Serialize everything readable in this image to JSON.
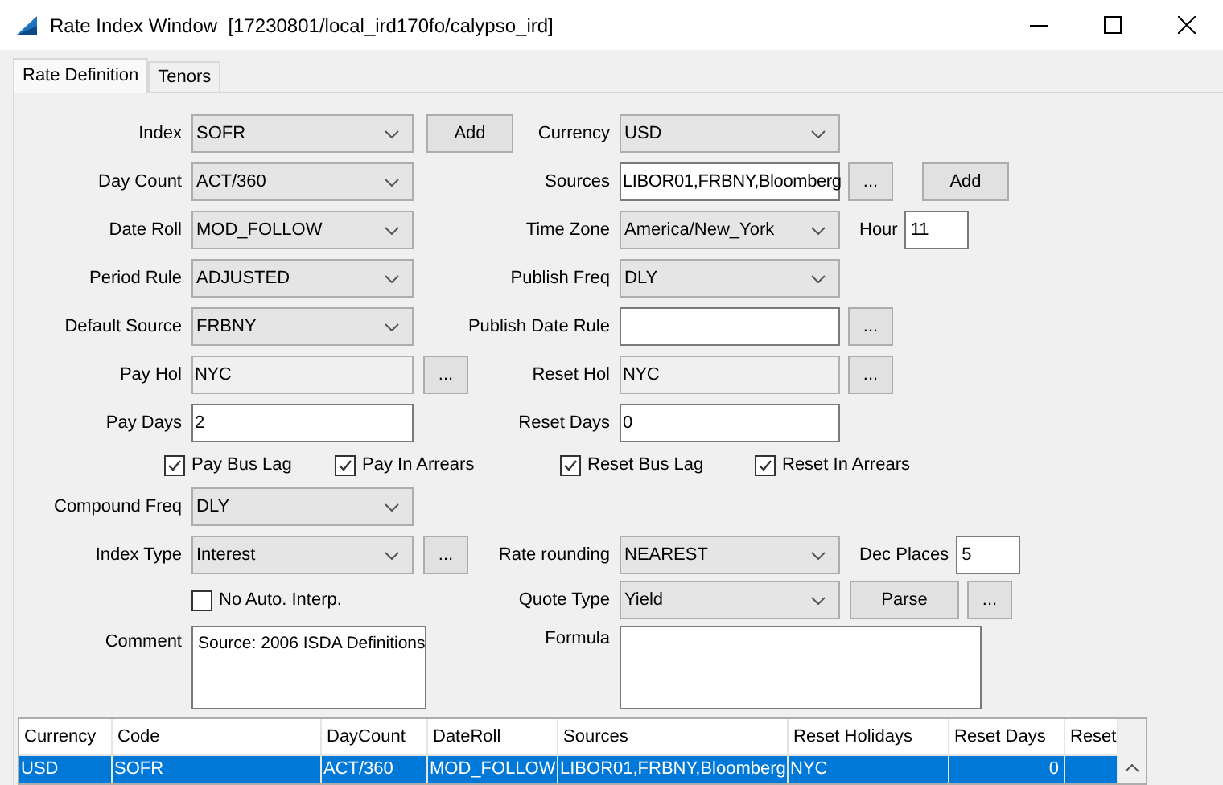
{
  "window": {
    "title": "Rate Index Window  [17230801/local_ird170fo/calypso_ird]"
  },
  "tabs": [
    {
      "label": "Rate Definition",
      "selected": true
    },
    {
      "label": "Tenors",
      "selected": false
    }
  ],
  "rows": [
    {
      "kind": "fields",
      "left": {
        "label": "Index",
        "field": {
          "kind": "dropdown",
          "value": "SOFR"
        },
        "button": "Add"
      },
      "right": {
        "label": "Currency",
        "field": {
          "kind": "dropdown",
          "value": "USD"
        }
      }
    },
    {
      "kind": "fields",
      "left": {
        "label": "Day Count",
        "field": {
          "kind": "dropdown",
          "value": "ACT/360"
        }
      },
      "right": {
        "label": "Sources",
        "field": {
          "kind": "text",
          "value": "LIBOR01,FRBNY,Bloomberg",
          "editable": true
        },
        "extras": [
          {
            "kind": "more",
            "label": "..."
          },
          {
            "kind": "button",
            "label": "Add"
          }
        ]
      }
    },
    {
      "kind": "fields",
      "left": {
        "label": "Date Roll",
        "field": {
          "kind": "dropdown",
          "value": "MOD_FOLLOW"
        }
      },
      "right": {
        "label": "Time Zone",
        "field": {
          "kind": "dropdown",
          "value": "America/New_York"
        },
        "extras": [
          {
            "kind": "labeled",
            "label": "Hour",
            "value": "11"
          }
        ]
      }
    },
    {
      "kind": "fields",
      "left": {
        "label": "Period Rule",
        "field": {
          "kind": "dropdown",
          "value": "ADJUSTED"
        }
      },
      "right": {
        "label": "Publish Freq",
        "field": {
          "kind": "dropdown",
          "value": "DLY"
        }
      }
    },
    {
      "kind": "fields",
      "left": {
        "label": "Default Source",
        "field": {
          "kind": "dropdown",
          "value": "FRBNY"
        }
      },
      "right": {
        "label": "Publish Date Rule",
        "field": {
          "kind": "text",
          "editable": true
        },
        "extras": [
          {
            "kind": "more",
            "label": "..."
          }
        ]
      }
    },
    {
      "kind": "fields",
      "left": {
        "label": "Pay Hol",
        "field": {
          "kind": "text",
          "value": "NYC",
          "editable": false
        },
        "button": "..."
      },
      "right": {
        "label": "Reset Hol",
        "field": {
          "kind": "text",
          "value": "NYC",
          "editable": false
        },
        "extras": [
          {
            "kind": "more",
            "label": "..."
          }
        ]
      }
    },
    {
      "kind": "fields",
      "left": {
        "label": "Pay Days",
        "field": {
          "kind": "text",
          "value": "2",
          "editable": true
        }
      },
      "right": {
        "label": "Reset Days",
        "field": {
          "kind": "text",
          "value": "0",
          "editable": true
        }
      }
    },
    {
      "kind": "checkboxes",
      "items": [
        {
          "label": "Pay Bus Lag",
          "checked": true
        },
        {
          "label": "Pay In Arrears",
          "checked": true
        },
        {
          "label": "Reset Bus Lag",
          "checked": true
        },
        {
          "label": "Reset In Arrears",
          "checked": true
        }
      ]
    },
    {
      "kind": "fields",
      "left": {
        "label": "Compound Freq",
        "field": {
          "kind": "dropdown",
          "value": "DLY"
        }
      }
    },
    {
      "kind": "fields",
      "left": {
        "label": "Index Type",
        "field": {
          "kind": "dropdown",
          "value": "Interest"
        },
        "button": "..."
      },
      "right": {
        "label": "Rate rounding",
        "field": {
          "kind": "dropdown",
          "value": "NEAREST"
        },
        "extras": [
          {
            "kind": "labeled",
            "label": "Dec Places",
            "value": "5"
          }
        ]
      }
    },
    {
      "kind": "fields",
      "left": {
        "field": {
          "kind": "checkbox",
          "label": "No Auto. Interp.",
          "checked": false
        }
      },
      "right": {
        "label": "Quote Type",
        "field": {
          "kind": "dropdown",
          "value": "Yield"
        },
        "extras": [
          {
            "kind": "button",
            "label": "Parse"
          },
          {
            "kind": "more",
            "label": "..."
          }
        ]
      }
    },
    {
      "kind": "memo",
      "left": {
        "label": "Comment",
        "field": {
          "kind": "textarea",
          "value": "Source: 2006 ISDA Definitions"
        }
      },
      "right": {
        "label": "Formula",
        "field": {
          "kind": "textarea"
        }
      }
    }
  ],
  "table": {
    "columns": [
      "Currency",
      "Code",
      "DayCount",
      "DateRoll",
      "Sources",
      "Reset Holidays",
      "Reset Days",
      "Reset"
    ],
    "rows": [
      {
        "selected": true,
        "cells": [
          "USD",
          "SOFR",
          "ACT/360",
          "MOD_FOLLOW",
          "LIBOR01,FRBNY,Bloomberg",
          "NYC",
          "0"
        ]
      }
    ]
  }
}
